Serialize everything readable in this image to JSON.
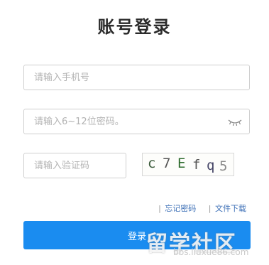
{
  "page": {
    "title": "账号登录"
  },
  "form": {
    "phone_placeholder": "请输入手机号",
    "password_placeholder": "请输入6~12位密码。",
    "code_placeholder": "请输入验证码",
    "captcha_chars": [
      "c",
      "7",
      "E",
      "f",
      "q",
      "5"
    ],
    "captcha_colors": [
      "#3a5a3a",
      "#555",
      "#2d6b2d",
      "#555",
      "#446",
      "#8a8a8a"
    ]
  },
  "links": {
    "forgot_password": "忘记密码",
    "file_download": "文件下载",
    "separator": "|"
  },
  "login_button": "登录",
  "watermark": {
    "text": "留学社区",
    "url": "bbs.liuxue86.com"
  }
}
